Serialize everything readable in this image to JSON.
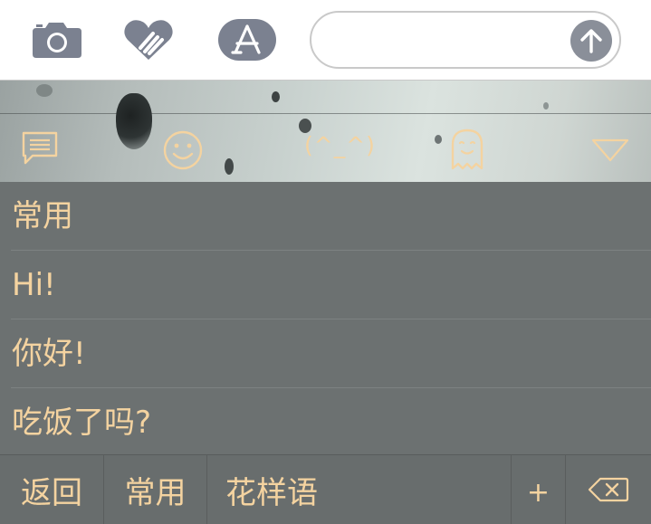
{
  "toolbar": {
    "icons": [
      "camera-icon",
      "heart-hands-icon",
      "app-store-icon"
    ],
    "send_icon": "arrow-up-icon"
  },
  "message_input": {
    "value": "",
    "placeholder": ""
  },
  "category_bar": {
    "icons": [
      "message-icon",
      "smiley-icon",
      "ghost-icon",
      "triangle-down-icon"
    ],
    "kaomoji_label": "(^_^)"
  },
  "list": {
    "items": [
      "常用",
      "Hi!",
      "你好!",
      "吃饭了吗?"
    ]
  },
  "bottom_bar": {
    "back_label": "返回",
    "common_label": "常用",
    "fancy_label": "花样语",
    "add_label": "+",
    "delete_icon": "backspace-icon"
  },
  "colors": {
    "accent": "#f4d3a0",
    "panel_bg": "#6c7171",
    "icon_gray": "#7b8190"
  }
}
